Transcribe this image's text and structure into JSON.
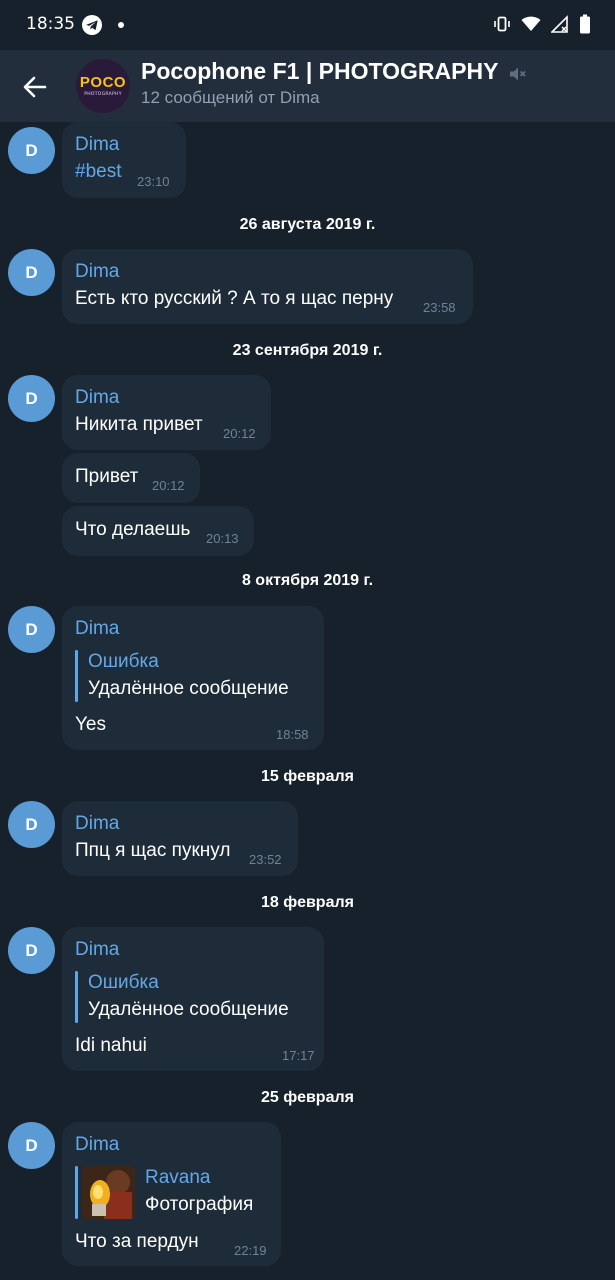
{
  "status_bar": {
    "time": "18:35",
    "icons": [
      "telegram-icon",
      "notification-dot",
      "vibrate-icon",
      "wifi-icon",
      "signal-icon",
      "battery-icon"
    ]
  },
  "header": {
    "title": "Pocophone F1 | PHOTOGRAPHY",
    "subtitle": "12 сообщений от Dima",
    "avatar_logo": "POCO",
    "avatar_logo_sub": "PHOTOGRAPHY",
    "muted": true
  },
  "colors": {
    "background": "#17212b",
    "header": "#232e3c",
    "bubble": "#1e2c3a",
    "accent": "#62a8e8",
    "avatar": "#5b9bd5",
    "time": "#6f8396"
  },
  "dates": {
    "d1": "26 августа 2019 г.",
    "d2": "23 сентября 2019 г.",
    "d3": "8 октября 2019 г.",
    "d4": "15 февраля",
    "d5": "18 февраля",
    "d6": "25 февраля"
  },
  "messages": {
    "m0": {
      "avatar": "D",
      "sender": "Dima",
      "text": "#best",
      "time": "23:10"
    },
    "m1": {
      "avatar": "D",
      "sender": "Dima",
      "text": "Есть кто русский ? А то я щас перну",
      "time": "23:58"
    },
    "m2": {
      "avatar": "D",
      "sender": "Dima",
      "text": "Никита привет",
      "time": "20:12"
    },
    "m3": {
      "text": "Привет",
      "time": "20:12"
    },
    "m4": {
      "text": "Что делаешь",
      "time": "20:13"
    },
    "m5": {
      "avatar": "D",
      "sender": "Dima",
      "reply_name": "Ошибка",
      "reply_text": "Удалённое сообщение",
      "text": "Yes",
      "time": "18:58"
    },
    "m6": {
      "avatar": "D",
      "sender": "Dima",
      "text": "Ппц я щас пукнул",
      "time": "23:52"
    },
    "m7": {
      "avatar": "D",
      "sender": "Dima",
      "reply_name": "Ошибка",
      "reply_text": "Удалённое сообщение",
      "text": "Idi nahui",
      "time": "17:17"
    },
    "m8": {
      "avatar": "D",
      "sender": "Dima",
      "reply_name": "Ravana",
      "reply_text": "Фотография",
      "text": "Что за пердун",
      "time": "22:19"
    }
  }
}
